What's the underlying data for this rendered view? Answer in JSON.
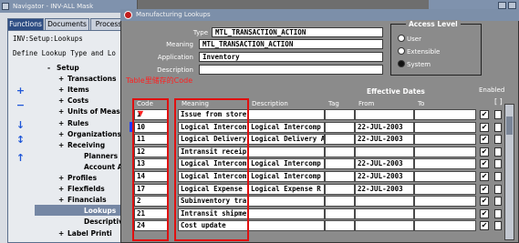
{
  "navigator": {
    "title": "Navigator - INV-ALL Mask",
    "tabs": [
      "Functions",
      "Documents",
      "Process"
    ],
    "path": "INV:Setup:Lookups",
    "subtitle": "Define Lookup Type and Lo",
    "tree": [
      {
        "pm": "-",
        "label": "Setup",
        "indent": 0
      },
      {
        "pm": "+",
        "label": "Transactions",
        "indent": 1
      },
      {
        "pm": "+",
        "label": "Items",
        "indent": 1
      },
      {
        "pm": "+",
        "label": "Costs",
        "indent": 1
      },
      {
        "pm": "+",
        "label": "Units of Meas",
        "indent": 1
      },
      {
        "pm": "+",
        "label": "Rules",
        "indent": 1
      },
      {
        "pm": "+",
        "label": "Organizations",
        "indent": 1
      },
      {
        "pm": "+",
        "label": "Receiving",
        "indent": 1
      },
      {
        "pm": "",
        "label": "Planners",
        "indent": 2
      },
      {
        "pm": "",
        "label": "Account Alia",
        "indent": 2
      },
      {
        "pm": "+",
        "label": "Profiles",
        "indent": 1
      },
      {
        "pm": "+",
        "label": "Flexfields",
        "indent": 1
      },
      {
        "pm": "+",
        "label": "Financials",
        "indent": 1
      },
      {
        "pm": "",
        "label": "Lookups",
        "indent": 2,
        "selected": true
      },
      {
        "pm": "",
        "label": "Descriptive",
        "indent": 2
      },
      {
        "pm": "+",
        "label": "Label Printi",
        "indent": 1
      }
    ],
    "tools": [
      "+",
      "−",
      "↓",
      "↕",
      "↑"
    ]
  },
  "dialog": {
    "title": "Manufacturing Lookups",
    "fields": {
      "type_label": "Type",
      "type_value": "MTL_TRANSACTION_ACTION",
      "meaning_label": "Meaning",
      "meaning_value": "MTL_TRANSACTION_ACTION",
      "application_label": "Application",
      "application_value": "Inventory",
      "description_label": "Description",
      "description_value": ""
    },
    "access_level": {
      "legend": "Access Level",
      "options": [
        "User",
        "Extensible",
        "System"
      ],
      "selected": "System"
    },
    "effective_dates_label": "Effective Dates",
    "enabled_label": "Enabled",
    "bracket_label": "[ ]",
    "columns": [
      "Code",
      "Meaning",
      "Description",
      "Tag",
      "From",
      "To"
    ],
    "rows": [
      {
        "code": "1",
        "meaning": "Issue from store",
        "description": "",
        "tag": "",
        "from": "",
        "to": "",
        "enabled": true
      },
      {
        "code": "10",
        "meaning": "Logical Intercom",
        "description": "Logical Intercomp",
        "tag": "",
        "from": "22-JUL-2003",
        "to": "",
        "enabled": true
      },
      {
        "code": "11",
        "meaning": "Logical Delivery",
        "description": "Logical Delivery A",
        "tag": "",
        "from": "22-JUL-2003",
        "to": "",
        "enabled": true
      },
      {
        "code": "12",
        "meaning": "Intransit receip",
        "description": "",
        "tag": "",
        "from": "",
        "to": "",
        "enabled": true
      },
      {
        "code": "13",
        "meaning": "Logical Intercom",
        "description": "Logical Intercomp",
        "tag": "",
        "from": "22-JUL-2003",
        "to": "",
        "enabled": true
      },
      {
        "code": "14",
        "meaning": "Logical Intercom",
        "description": "Logical Intercomp",
        "tag": "",
        "from": "22-JUL-2003",
        "to": "",
        "enabled": true
      },
      {
        "code": "17",
        "meaning": "Logical Expense",
        "description": "Logical Expense R",
        "tag": "",
        "from": "22-JUL-2003",
        "to": "",
        "enabled": true
      },
      {
        "code": "2",
        "meaning": "Subinventory tra",
        "description": "",
        "tag": "",
        "from": "",
        "to": "",
        "enabled": true
      },
      {
        "code": "21",
        "meaning": "Intransit shipme",
        "description": "",
        "tag": "",
        "from": "",
        "to": "",
        "enabled": true
      },
      {
        "code": "24",
        "meaning": "Cost update",
        "description": "",
        "tag": "",
        "from": "",
        "to": "",
        "enabled": true
      }
    ],
    "annotation": "Table里储存的Code"
  },
  "colors": {
    "annotation": "#e01010",
    "dialog_bg": "#8b8b8b",
    "title_bar": "#7c8fa9",
    "selected_tab": "#2f4e84"
  }
}
